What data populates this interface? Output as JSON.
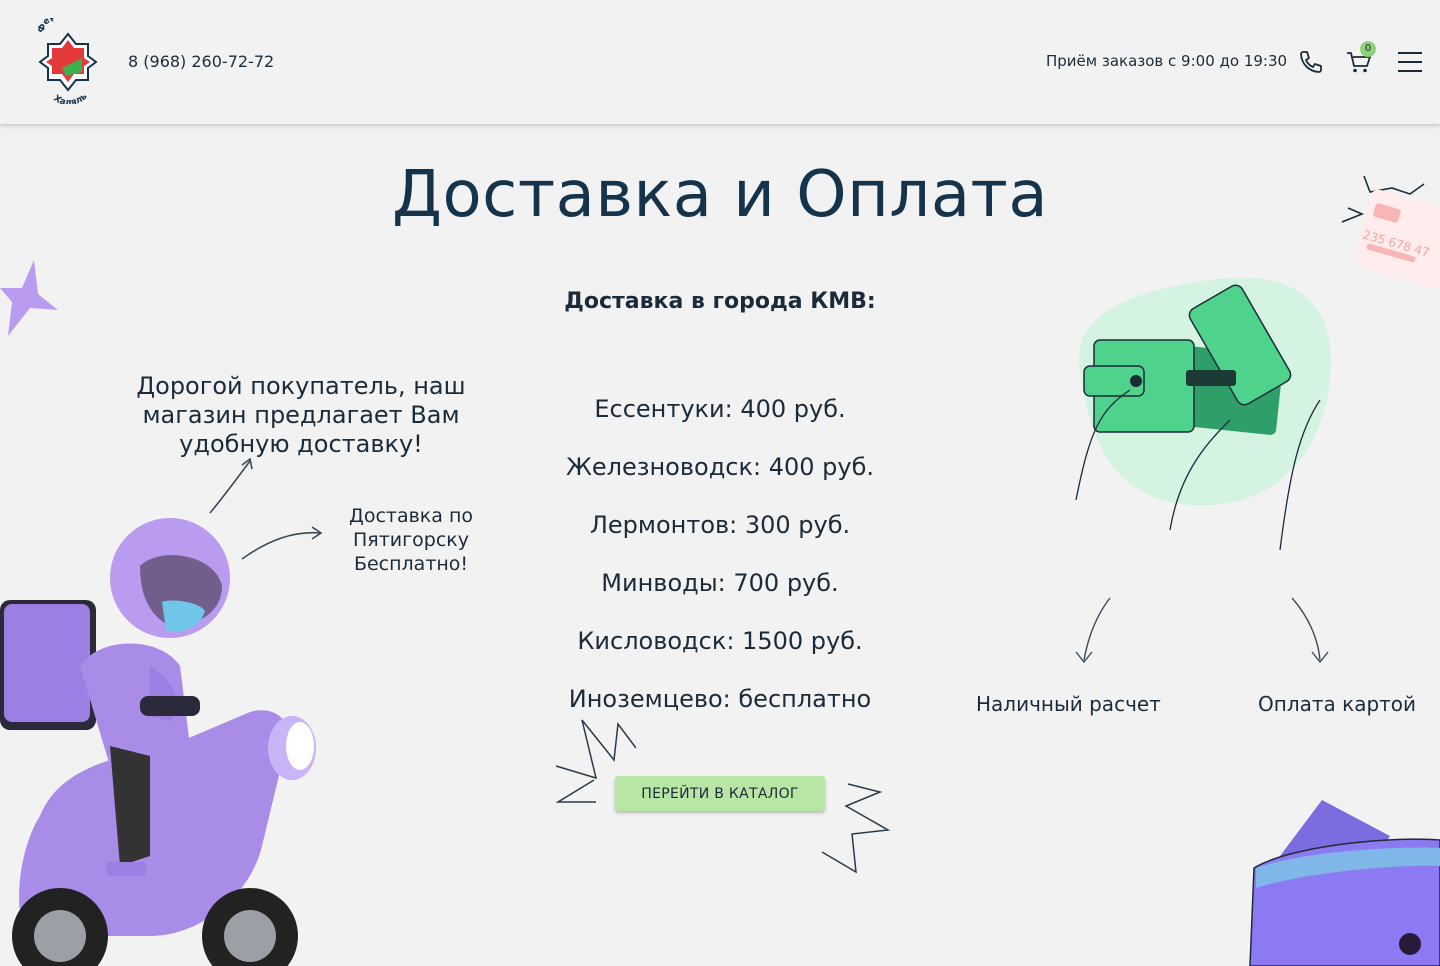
{
  "header": {
    "logo_top_text": "Ферма 26",
    "logo_bottom_text": "Халяль",
    "phone": "8 (968) 260-72-72",
    "hours": "Приём заказов с 9:00 до 19:30",
    "cart_count": "0",
    "icons": [
      "phone-icon",
      "cart-icon",
      "menu-icon"
    ]
  },
  "main": {
    "title": "Доставка и Оплата",
    "subtitle": "Доставка в города КМВ:",
    "prices": [
      "Ессентуки: 400 руб.",
      "Железноводск:  400 руб.",
      "Лермонтов: 300 руб.",
      "Минводы: 700 руб.",
      "Кисловодск: 1500 руб.",
      "Иноземцево: бесплатно"
    ],
    "intro": "Дорогой покупатель, наш магазин предлагает Вам удобную доставку!",
    "free_delivery": "Доставка по Пятигорску Бесплатно!",
    "catalog_button": "ПЕРЕЙТИ В КАТАЛОГ",
    "payment": {
      "cash": "Наличный расчет",
      "card": "Оплата картой"
    },
    "card_number_fragment": "235 678 47"
  },
  "colors": {
    "background": "#f2f2f2",
    "title": "#15334a",
    "accent_green": "#b8e6a4",
    "wallet_green": "#4fd28c",
    "courier_purple": "#a98be8",
    "badge": "#8fd07a"
  }
}
